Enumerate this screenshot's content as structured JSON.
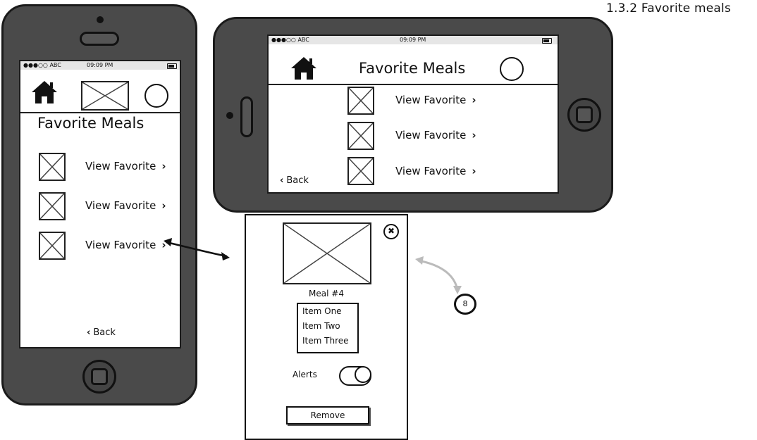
{
  "page_title": "1.3.2 Favorite meals",
  "portrait": {
    "status": {
      "carrier": "●●●○○ ABC",
      "time": "09:09 PM"
    },
    "heading": "Favorite Meals",
    "rows": [
      {
        "label": "View Favorite",
        "chevron": "›"
      },
      {
        "label": "View Favorite",
        "chevron": "›"
      },
      {
        "label": "View Favorite",
        "chevron": "›"
      }
    ],
    "back_label": "Back",
    "back_chevron": "‹"
  },
  "landscape": {
    "status": {
      "carrier": "●●●○○ ABC",
      "time": "09:09 PM"
    },
    "heading": "Favorite Meals",
    "rows": [
      {
        "label": "View Favorite",
        "chevron": "›"
      },
      {
        "label": "View Favorite",
        "chevron": "›"
      },
      {
        "label": "View Favorite",
        "chevron": "›"
      }
    ],
    "back_label": "Back",
    "back_chevron": "‹"
  },
  "modal": {
    "meal_title": "Meal #4",
    "items": [
      "Item One",
      "Item Two",
      "Item Three"
    ],
    "alerts_label": "Alerts",
    "alerts_on": true,
    "remove_label": "Remove",
    "close_glyph": "✖"
  },
  "annotation": {
    "badge": "8"
  }
}
